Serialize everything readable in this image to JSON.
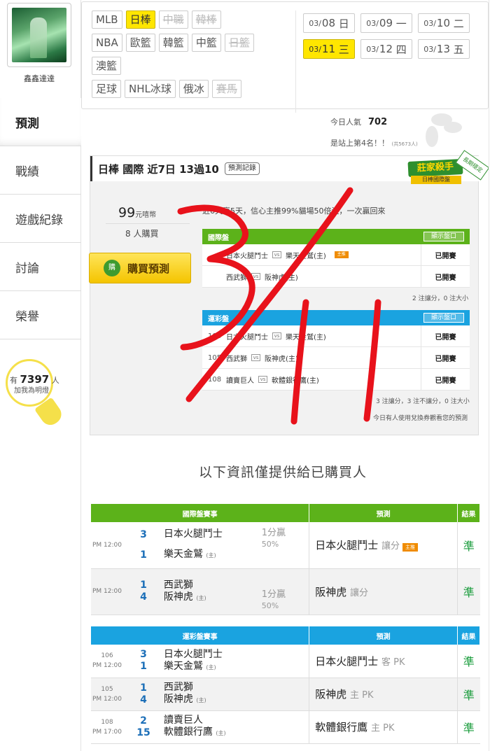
{
  "user": {
    "name": "鑫鑫達達"
  },
  "side_nav": [
    "預測",
    "戰績",
    "遊戲紀錄",
    "討論",
    "榮譽"
  ],
  "bulb": {
    "prefix": "有",
    "count": "7397",
    "suffix": "人",
    "line2": "加我為明燈"
  },
  "leagues": {
    "row1": [
      "MLB",
      "日棒",
      "中職",
      "韓棒"
    ],
    "row2": [
      "NBA",
      "歐籃",
      "韓籃",
      "中籃",
      "日籃"
    ],
    "row3": [
      "澳籃"
    ],
    "row4": [
      "足球",
      "NHL冰球",
      "俄冰",
      "賽馬"
    ]
  },
  "dates": [
    {
      "md": "03/",
      "d": "08",
      "w": "日"
    },
    {
      "md": "03/",
      "d": "09",
      "w": "一"
    },
    {
      "md": "03/",
      "d": "10",
      "w": "二"
    },
    {
      "md": "03/",
      "d": "11",
      "w": "三"
    },
    {
      "md": "03/",
      "d": "12",
      "w": "四"
    },
    {
      "md": "03/",
      "d": "13",
      "w": "五"
    }
  ],
  "popularity": {
    "label": "今日人氣",
    "value": "702",
    "rank_text": "是站上第4名！！",
    "rank_note": "(共5673人)"
  },
  "card": {
    "title": "日棒 國際 近7日 13過10",
    "record_button": "預測記錄",
    "badge_main": "莊家殺手",
    "badge_sub": "日棒國際盤",
    "badge_tag": "長期穩定",
    "price": "99",
    "price_unit": "元嘻幣",
    "buyers": "8 人購買",
    "buy_button": "購買預測",
    "buy_icon": "購",
    "desc": "近6天贏5天，信心主推99%貓場50倍注，一次贏回來",
    "intl_table": {
      "title": "國際盤",
      "show_button": "顯示盤口",
      "rows": [
        {
          "home": "日本火腿鬥士",
          "away": "樂天金鷲(主)",
          "host": "主推",
          "status": "已開賽"
        },
        {
          "home": "西武獅",
          "away": "阪神虎(主)",
          "status": "已開賽"
        }
      ],
      "note": "2 注讓分，0 注大小"
    },
    "lottery_table": {
      "title": "運彩盤",
      "show_button": "顯示盤口",
      "rows": [
        {
          "num": "106",
          "home": "日本火腿鬥士",
          "away": "樂天金鷲(主)",
          "status": "已開賽"
        },
        {
          "num": "105",
          "home": "西武獅",
          "away": "阪神虎(主)",
          "status": "已開賽"
        },
        {
          "num": "108",
          "home": "讀賣巨人",
          "away": "軟體銀行鷹(主)",
          "status": "已開賽"
        }
      ],
      "note": "3 注讓分，3 注不讓分，0 注大小"
    },
    "coupon_note": "今日有人使用兌換券觀看您的預測"
  },
  "info_title": "以下資訊僅提供給已購買人",
  "results_intl": {
    "headers": [
      "國際盤賽事",
      "預測",
      "結果"
    ],
    "rows": [
      {
        "time": "PM 12:00",
        "s1": "3",
        "t1": "日本火腿鬥士",
        "s2": "1",
        "t2": "樂天金鷲",
        "t2tag": "(主)",
        "line": "1分贏",
        "pct": "50%",
        "pick": "日本火腿鬥士",
        "pick_type": "讓分",
        "host": "主推",
        "result": "準"
      },
      {
        "time": "PM 12:00",
        "s1": "1",
        "t1": "西武獅",
        "s2": "4",
        "t2": "阪神虎",
        "t2tag": "(主)",
        "line": "1分贏",
        "pct": "50%",
        "pick": "阪神虎",
        "pick_type": "讓分",
        "result": "準"
      }
    ]
  },
  "results_lottery": {
    "headers": [
      "運彩盤賽事",
      "預測",
      "結果"
    ],
    "rows": [
      {
        "num": "106",
        "time": "PM 12:00",
        "s1": "3",
        "t1": "日本火腿鬥士",
        "s2": "1",
        "t2": "樂天金鷲",
        "t2tag": "(主)",
        "pick": "日本火腿鬥士",
        "pick_type": "客 PK",
        "result": "準"
      },
      {
        "num": "105",
        "time": "PM 12:00",
        "s1": "1",
        "t1": "西武獅",
        "s2": "4",
        "t2": "阪神虎",
        "t2tag": "(主)",
        "pick": "阪神虎",
        "pick_type": "主 PK",
        "result": "準"
      },
      {
        "num": "108",
        "time": "PM 17:00",
        "s1": "2",
        "t1": "讀賣巨人",
        "s2": "15",
        "t2": "軟體銀行鷹",
        "t2tag": "(主)",
        "pick": "軟體銀行鷹",
        "pick_type": "主 PK",
        "result": "準"
      }
    ]
  },
  "colors": {
    "accent": "#ffe600",
    "green": "#5cb21a",
    "blue": "#1aa3e0",
    "annotation": "#e8121b"
  }
}
